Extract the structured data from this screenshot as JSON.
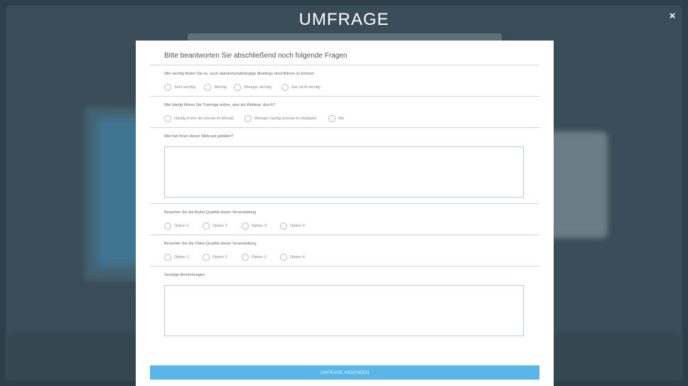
{
  "modal": {
    "title": "UMFRAGE",
    "close_label": "×"
  },
  "survey": {
    "heading": "Bitte beantworten Sie abschließend noch folgende Fragen",
    "q1": {
      "label": "Wie wichtig finden Sie es, euch standortunabhängige Meetings durchführen zu können",
      "options": [
        "Sehr wichtig",
        "Wichtig",
        "Weniger wichtig",
        "Gar nicht wichtig"
      ]
    },
    "q2": {
      "label": "Wie häufig führen Sie Trainings online, also als Webinar, durch?",
      "options": [
        "Häufig (mehr als einmal im Monat)",
        "Weniger häufig (einmal im Halbjahr)",
        "Nie"
      ]
    },
    "q3": {
      "label": "Wie hat Ihnen dieser Webcast gefallen?",
      "value": ""
    },
    "q4": {
      "label": "Bewerten Sie die Audio-Qualität dieser Veranstaltung",
      "options": [
        "Option 1",
        "Option 2",
        "Option 3",
        "Option 4"
      ]
    },
    "q5": {
      "label": "Bewerten Sie die Video-Qualität dieser Veranstaltung",
      "options": [
        "Option 1",
        "Option 2",
        "Option 3",
        "Option 4"
      ]
    },
    "q6": {
      "label": "Sonstige Anmerkungen",
      "value": ""
    },
    "submit_label": "UMFRAGE ABSENDEN"
  },
  "colors": {
    "accent": "#5ab6e8",
    "overlay": "#2d3f4a"
  }
}
